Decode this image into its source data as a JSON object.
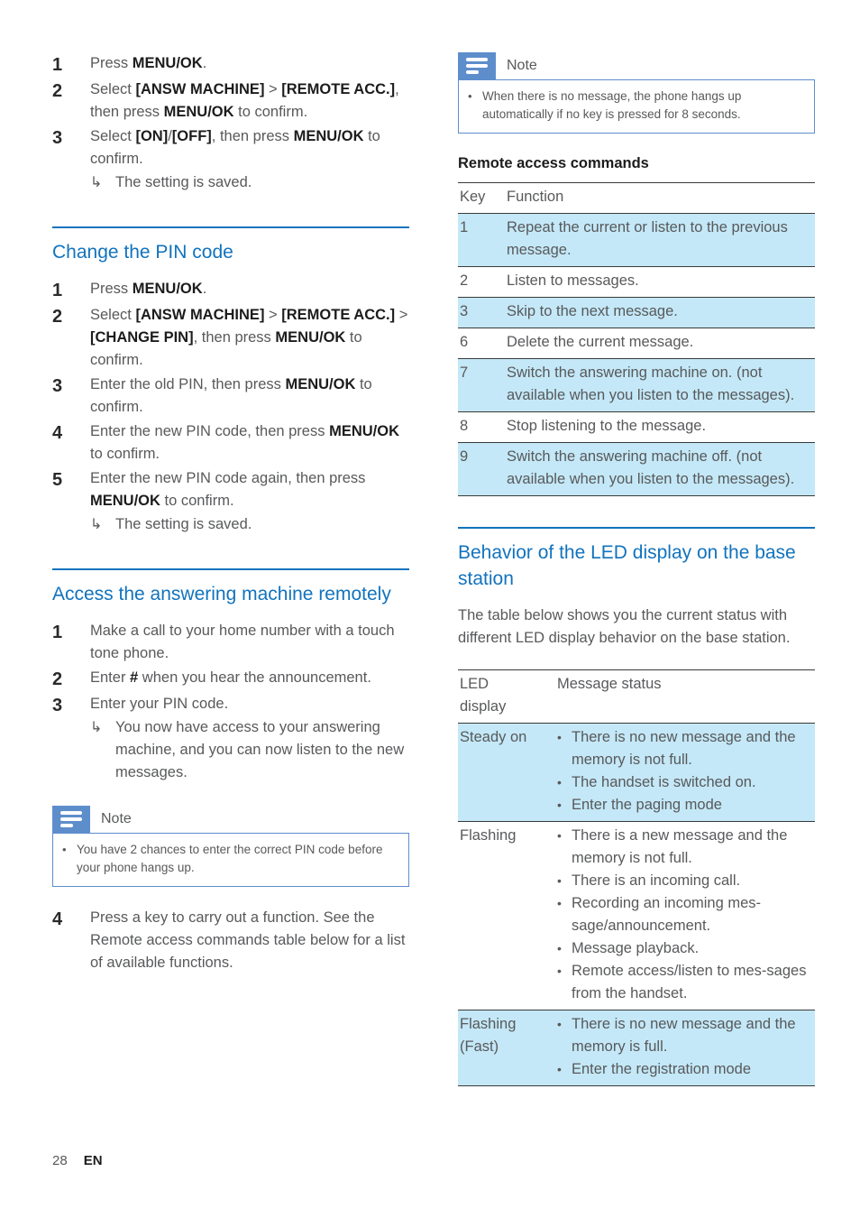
{
  "colors": {
    "heading_blue": "#1273bd",
    "note_badge_blue": "#5d8ecb",
    "table_highlight": "#c4e8f7",
    "body_text": "#58595b",
    "bold_text": "#1c1c1c"
  },
  "left_column": {
    "steps_top": [
      {
        "num": "1",
        "text_html": "Press <b>MENU/OK</b>."
      },
      {
        "num": "2",
        "text_html": "Select <b>[ANSW MACHINE]</b> &gt; <b>[REMOTE ACC.]</b>, then press <b>MENU/OK</b> to confirm."
      },
      {
        "num": "3",
        "text_html": "Select <b>[ON]</b>/<b>[OFF]</b>, then press <b>MENU/OK</b> to confirm.",
        "sub": "The setting is saved."
      }
    ],
    "section_change_pin": {
      "heading": "Change the PIN code",
      "steps": [
        {
          "num": "1",
          "text_html": "Press <b>MENU/OK</b>."
        },
        {
          "num": "2",
          "text_html": "Select <b>[ANSW MACHINE]</b> &gt; <b>[REMOTE ACC.]</b> &gt; <b>[CHANGE PIN]</b>, then press <b>MENU/OK</b> to confirm."
        },
        {
          "num": "3",
          "text_html": "Enter the old PIN, then press <b>MENU/OK</b> to confirm."
        },
        {
          "num": "4",
          "text_html": "Enter the new PIN code, then press <b>MENU/OK</b> to confirm."
        },
        {
          "num": "5",
          "text_html": "Enter the new PIN code again, then press <b>MENU/OK</b> to confirm.",
          "sub": "The setting is saved."
        }
      ]
    },
    "section_remote_access": {
      "heading": "Access the answering machine remotely",
      "steps": [
        {
          "num": "1",
          "text_html": "Make a call to your home number with a touch tone phone."
        },
        {
          "num": "2",
          "text_html": "Enter <b>#</b> when you hear the announcement."
        },
        {
          "num": "3",
          "text_html": "Enter your PIN code.",
          "sub": "You now have access to your answering machine, and you can now listen to the new messages."
        }
      ],
      "note": {
        "title": "Note",
        "items": [
          "You have 2 chances to enter the correct PIN code before your phone hangs up."
        ]
      },
      "step_after_note": {
        "num": "4",
        "text_html": "Press a key to carry out a function. See the Remote access commands table below for a list of available functions."
      }
    }
  },
  "right_column": {
    "note": {
      "title": "Note",
      "items": [
        "When there is no message, the phone hangs up automatically if no key is pressed for 8 seconds."
      ]
    },
    "remote_commands": {
      "heading": "Remote access commands",
      "columns": [
        "Key",
        "Function"
      ],
      "rows": [
        {
          "key": "1",
          "function": "Repeat the current or listen to the previous message.",
          "highlight": true
        },
        {
          "key": "2",
          "function": "Listen to messages.",
          "highlight": false
        },
        {
          "key": "3",
          "function": "Skip to the next message.",
          "highlight": true
        },
        {
          "key": "6",
          "function": "Delete the current message.",
          "highlight": false
        },
        {
          "key": "7",
          "function": "Switch the answering machine on. (not available when you listen to the messages).",
          "highlight": true
        },
        {
          "key": "8",
          "function": "Stop listening to the message.",
          "highlight": false
        },
        {
          "key": "9",
          "function": "Switch the answering machine off. (not available when you listen to the messages).",
          "highlight": true
        }
      ]
    },
    "led_section": {
      "heading": "Behavior of the LED display on the base station",
      "intro": "The table below shows you the current status with different LED display behavior on the base station.",
      "columns": [
        "LED display",
        "Message status"
      ],
      "rows": [
        {
          "state": "Steady on",
          "bullets": [
            "There is no new message and the memory is not full.",
            "The handset is switched on.",
            "Enter the paging mode"
          ],
          "highlight": true
        },
        {
          "state": "Flashing",
          "bullets": [
            "There is a new message and the memory is not full.",
            "There is an incoming call.",
            "Recording an incoming mes-sage/announcement.",
            "Message playback.",
            "Remote access/listen to mes-sages from the handset."
          ],
          "highlight": false
        },
        {
          "state": "Flashing (Fast)",
          "bullets": [
            "There is no new message and the memory is full.",
            "Enter the registration mode"
          ],
          "highlight": true
        }
      ]
    }
  },
  "footer": {
    "page_number": "28",
    "language": "EN"
  }
}
